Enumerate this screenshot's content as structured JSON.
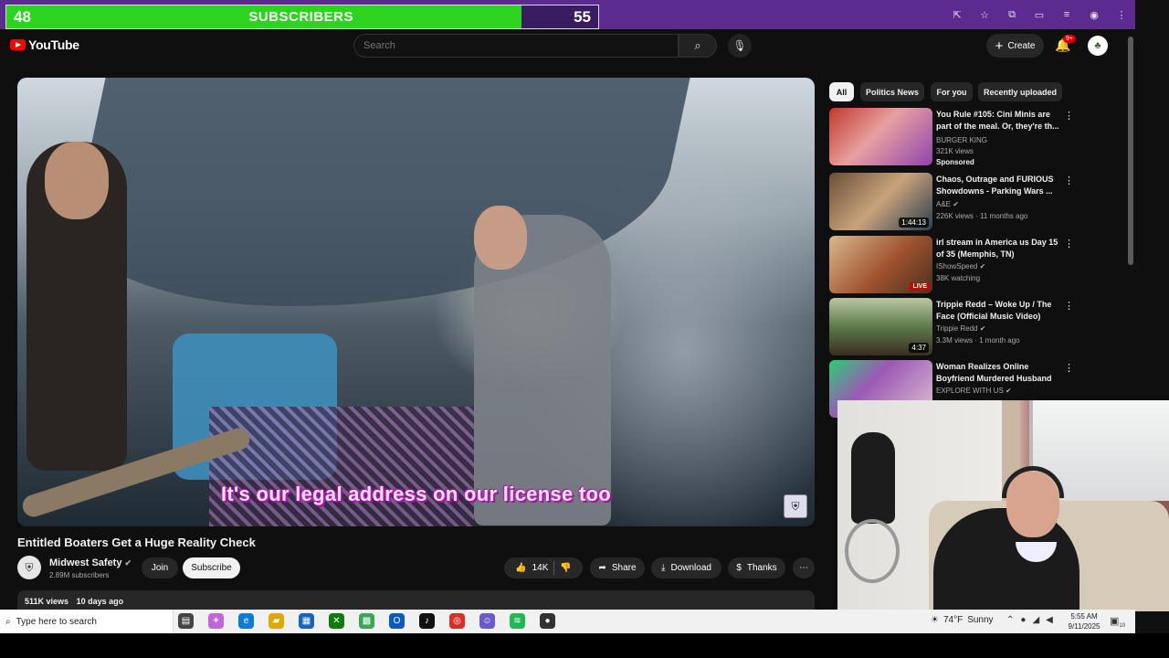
{
  "overlay": {
    "left_count": "48",
    "label": "SUBSCRIBERS",
    "right_count": "55"
  },
  "browser": {
    "icons": [
      "cast-icon",
      "star-icon",
      "extensions-icon",
      "sidebar-icon",
      "menu-list-icon",
      "profile-icon",
      "kebab-icon"
    ]
  },
  "header": {
    "logo": "YouTube",
    "search_placeholder": "Search",
    "create_label": "Create",
    "notification_badge": "9+"
  },
  "video": {
    "caption": "It's our legal address on our license too",
    "title": "Entitled Boaters Get a Huge Reality Check",
    "channel": "Midwest Safety",
    "subscribers": "2.89M subscribers",
    "join_label": "Join",
    "subscribe_label": "Subscribe",
    "likes": "14K",
    "share_label": "Share",
    "download_label": "Download",
    "thanks_label": "Thanks",
    "views": "511K views",
    "age": "10 days ago"
  },
  "chips": [
    "All",
    "Politics News",
    "For you",
    "Recently uploaded"
  ],
  "recommendations": [
    {
      "title": "You Rule #105: Cini Minis are part of the meal. Or, they're th...",
      "channel": "BURGER KING",
      "meta": "321K views",
      "sponsored": "Sponsored",
      "duration": "",
      "live": ""
    },
    {
      "title": "Chaos, Outrage and FURIOUS Showdowns - Parking Wars ...",
      "channel": "A&E",
      "meta": "226K views · 11 months ago",
      "sponsored": "",
      "duration": "1:44:13",
      "live": ""
    },
    {
      "title": "irl stream in America us Day 15 of 35 (Memphis, TN)",
      "channel": "IShowSpeed",
      "meta": "38K watching",
      "sponsored": "",
      "duration": "",
      "live": "LIVE"
    },
    {
      "title": "Trippie Redd – Woke Up / The Face (Official Music Video)",
      "channel": "Trippie Redd",
      "meta": "3.3M views · 1 month ago",
      "sponsored": "",
      "duration": "4:37",
      "live": ""
    },
    {
      "title": "Woman Realizes Online Boyfriend Murdered Husband",
      "channel": "EXPLORE WITH US",
      "meta": "",
      "sponsored": "",
      "duration": "",
      "live": ""
    }
  ],
  "taskbar": {
    "search_placeholder": "Type here to search",
    "temperature": "74°F",
    "weather": "Sunny",
    "time": "5:55 AM",
    "date": "9/11/2025",
    "notification_count": "10"
  },
  "colors": {
    "overlay_green": "#2bd41d",
    "overlay_purple": "#3a1c62",
    "yt_red": "#ff0000",
    "caption_magenta": "#c020c0"
  }
}
